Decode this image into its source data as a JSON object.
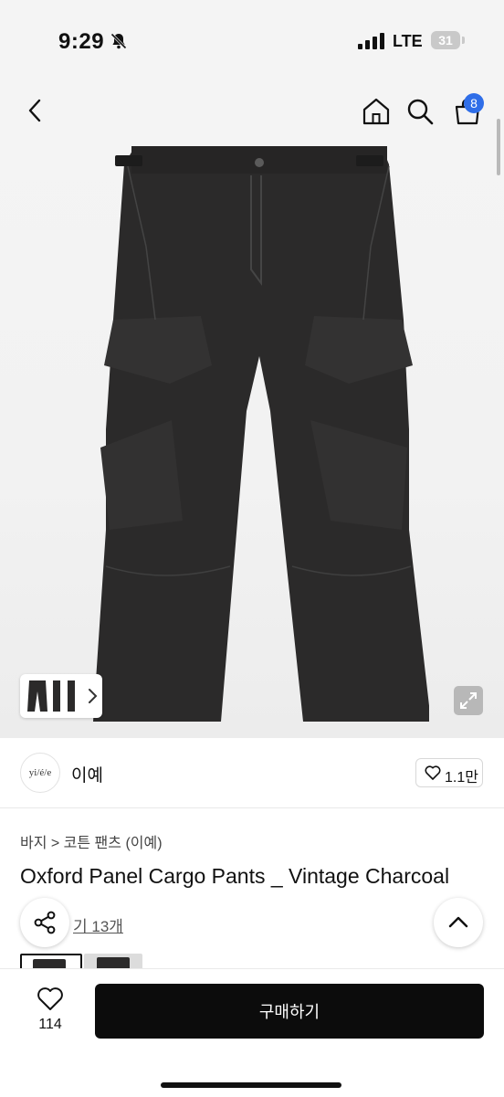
{
  "status_bar": {
    "time": "9:29",
    "network": "LTE",
    "battery": "31"
  },
  "header": {
    "cart_count": "8"
  },
  "product": {
    "brand_logo_text": "yi/é/e",
    "brand_name": "이예",
    "like_count": "1.1만",
    "breadcrumb": "바지 > 코튼 팬츠 (이예)",
    "title": "Oxford Panel Cargo Pants _ Vintage Charcoal",
    "review_link": "기 13개"
  },
  "bottom_bar": {
    "wish_count": "114",
    "buy_label": "구매하기"
  },
  "colors": {
    "accent": "#2f6ee8",
    "buy_button": "#0c0c0c",
    "product_color": "#2b2a2a"
  }
}
